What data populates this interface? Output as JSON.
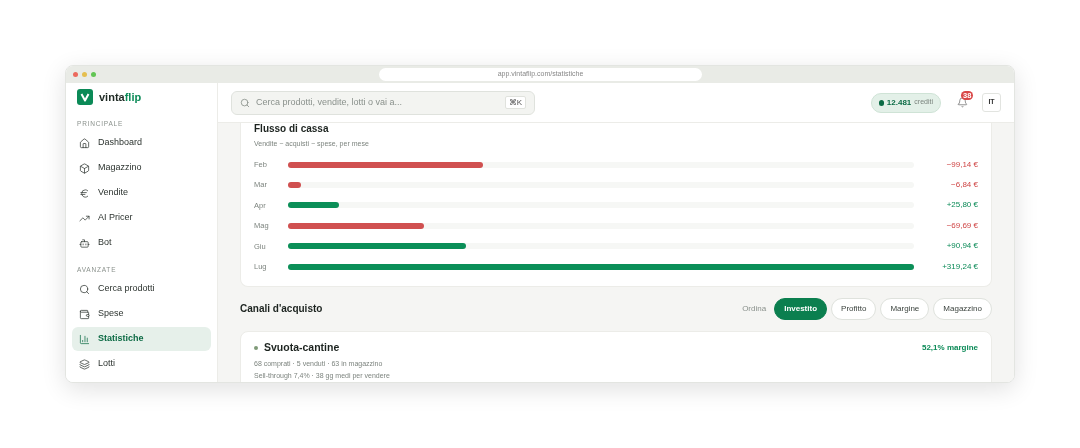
{
  "browser": {
    "url": "app.vintaflip.com/statistiche"
  },
  "brand": {
    "name_a": "vinta",
    "name_b": "flip"
  },
  "sidebar": {
    "sections": [
      {
        "title": "PRINCIPALE",
        "items": [
          {
            "label": "Dashboard",
            "selected": false
          },
          {
            "label": "Magazzino",
            "selected": false
          },
          {
            "label": "Vendite",
            "selected": false
          },
          {
            "label": "AI Pricer",
            "selected": false
          },
          {
            "label": "Bot",
            "selected": false
          }
        ]
      },
      {
        "title": "AVANZATE",
        "items": [
          {
            "label": "Cerca prodotti",
            "selected": false
          },
          {
            "label": "Spese",
            "selected": false
          },
          {
            "label": "Statistiche",
            "selected": true
          },
          {
            "label": "Lotti",
            "selected": false
          }
        ]
      }
    ]
  },
  "header": {
    "search": {
      "placeholder": "Cerca prodotti, vendite, lotti o vai a...",
      "shortcut": "⌘K"
    },
    "credits": {
      "amount": "12.481",
      "label": "crediti"
    },
    "notifications": {
      "count": "38"
    },
    "language": "IT"
  },
  "cash_flow": {
    "title": "Flusso di cassa",
    "subtitle": "Vendite − acquisti − spese, per mese",
    "rows": [
      {
        "month": "Feb",
        "kind": "negative",
        "level": 0.311,
        "amount": "−99,14 €"
      },
      {
        "month": "Mar",
        "kind": "negative",
        "level": 0.021,
        "amount": "−6,84 €"
      },
      {
        "month": "Apr",
        "kind": "positive",
        "level": 0.081,
        "amount": "+25,80 €"
      },
      {
        "month": "Mag",
        "kind": "negative",
        "level": 0.218,
        "amount": "−69,69 €"
      },
      {
        "month": "Giu",
        "kind": "positive",
        "level": 0.285,
        "amount": "+90,94 €"
      },
      {
        "month": "Lug",
        "kind": "positive",
        "level": 1,
        "amount": "+319,24 €"
      }
    ]
  },
  "channels": {
    "title": "Canali d'acquisto",
    "sort_label": "Ordina",
    "sort_options": [
      {
        "label": "Investito",
        "selected": true
      },
      {
        "label": "Profitto",
        "selected": false
      },
      {
        "label": "Margine",
        "selected": false
      },
      {
        "label": "Magazzino",
        "selected": false
      }
    ],
    "items": [
      {
        "name": "Svuota-cantine",
        "color": "#7f9a78",
        "margin": "52,1% margine",
        "line_1": "68 comprati · 5 venduti · 63 in magazzino",
        "line_2": "Sell-through 7,4% · 38 gg medi per vendere"
      }
    ]
  }
}
